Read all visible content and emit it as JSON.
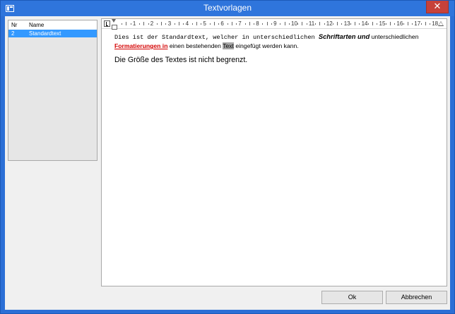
{
  "window": {
    "title": "Textvorlagen",
    "close_symbol": "✕",
    "icons": {
      "app": "app-window-icon",
      "close": "close-icon"
    }
  },
  "list": {
    "headers": {
      "nr": "Nr",
      "name": "Name"
    },
    "rows": [
      {
        "nr": "2",
        "name": "Standardtext",
        "selected": true
      }
    ]
  },
  "ruler": {
    "numbers": [
      "1",
      "2",
      "3",
      "4",
      "5",
      "6",
      "7",
      "8",
      "9",
      "10",
      "11",
      "12",
      "13",
      "14",
      "15",
      "16",
      "17",
      "18"
    ]
  },
  "editor": {
    "p1_mono": "Dies ist der Standardtext, welcher in unterschiedlichen ",
    "p1_bi": "Schriftarten und",
    "p1_rest": " unterschiedlichen",
    "p1_red": "Formatierungen in",
    "p1_mid": " einen bestehenden ",
    "p1_hl": "Text",
    "p1_end": " eingefügt werden kann.",
    "p2": "Die Größe des Textes ist nicht begrenzt."
  },
  "buttons": {
    "ok": "Ok",
    "cancel": "Abbrechen"
  },
  "colors": {
    "titlebar": "#2f75dc",
    "close": "#c7413a",
    "selection": "#3399ff",
    "format_red": "#d40000"
  }
}
